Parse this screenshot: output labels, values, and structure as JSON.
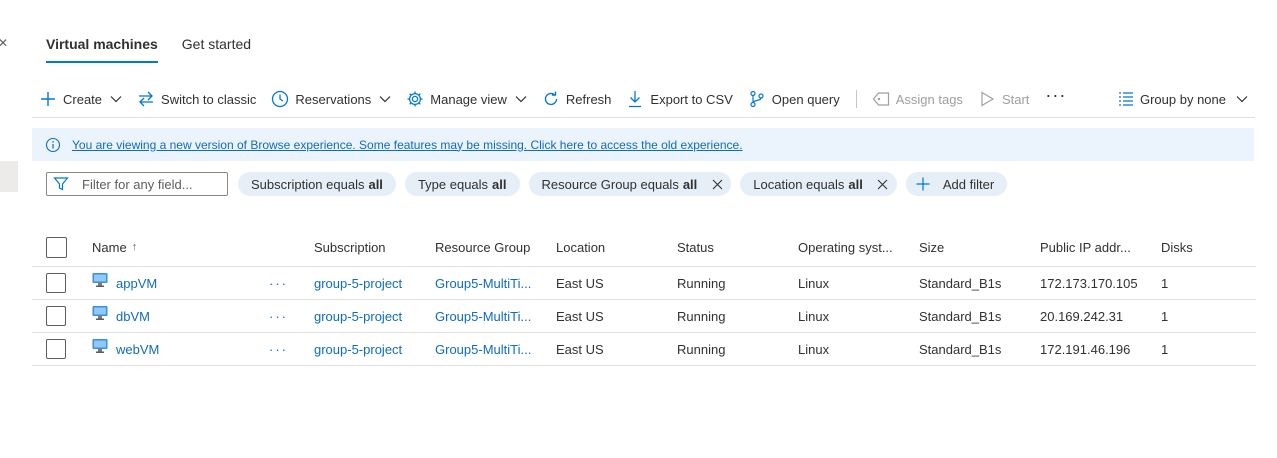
{
  "tabs": [
    {
      "label": "Virtual machines",
      "active": true
    },
    {
      "label": "Get started",
      "active": false
    }
  ],
  "toolbar": {
    "create": "Create",
    "switch_classic": "Switch to classic",
    "reservations": "Reservations",
    "manage_view": "Manage view",
    "refresh": "Refresh",
    "export_csv": "Export to CSV",
    "open_query": "Open query",
    "assign_tags": "Assign tags",
    "start": "Start",
    "more": "···",
    "group_by": "Group by none"
  },
  "banner": {
    "text": "You are viewing a new version of Browse experience. Some features may be missing. Click here to access the old experience."
  },
  "filters": {
    "search_placeholder": "Filter for any field...",
    "pills": [
      {
        "label": "Subscription equals",
        "value": "all",
        "removable": false
      },
      {
        "label": "Type equals",
        "value": "all",
        "removable": false
      },
      {
        "label": "Resource Group equals",
        "value": "all",
        "removable": true
      },
      {
        "label": "Location equals",
        "value": "all",
        "removable": true
      }
    ],
    "add_filter": "Add filter"
  },
  "table": {
    "columns": {
      "name": "Name",
      "name_sort": "↑",
      "subscription": "Subscription",
      "resource_group": "Resource Group",
      "location": "Location",
      "status": "Status",
      "os": "Operating syst...",
      "size": "Size",
      "public_ip": "Public IP addr...",
      "disks": "Disks"
    },
    "rows": [
      {
        "name": "appVM",
        "more": "···",
        "subscription": "group-5-project",
        "resource_group": "Group5-MultiTi...",
        "location": "East US",
        "status": "Running",
        "os": "Linux",
        "size": "Standard_B1s",
        "public_ip": "172.173.170.105",
        "disks": "1"
      },
      {
        "name": "dbVM",
        "more": "···",
        "subscription": "group-5-project",
        "resource_group": "Group5-MultiTi...",
        "location": "East US",
        "status": "Running",
        "os": "Linux",
        "size": "Standard_B1s",
        "public_ip": "20.169.242.31",
        "disks": "1"
      },
      {
        "name": "webVM",
        "more": "···",
        "subscription": "group-5-project",
        "resource_group": "Group5-MultiTi...",
        "location": "East US",
        "status": "Running",
        "os": "Linux",
        "size": "Standard_B1s",
        "public_ip": "172.191.46.196",
        "disks": "1"
      }
    ]
  },
  "colors": {
    "accent": "#0078d4",
    "link": "#0f6cbd",
    "banner_bg": "#ebf3fc",
    "pill_bg": "#e6eef8"
  }
}
